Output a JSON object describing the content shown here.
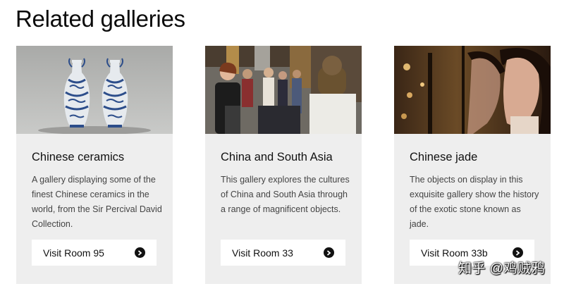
{
  "page": {
    "title": "Related galleries"
  },
  "galleries": [
    {
      "title": "Chinese ceramics",
      "description": "A gallery displaying some of the finest Chinese ceramics in the world, from the Sir Percival David Collection.",
      "link_label": "Visit Room 95",
      "image_subject": "blue-and-white-vases"
    },
    {
      "title": "China and South Asia",
      "description": "This gallery explores the cultures of China and South Asia through a range of magnificent objects.",
      "link_label": "Visit Room 33",
      "image_subject": "museum-visitors"
    },
    {
      "title": "Chinese jade",
      "description": "The objects on display in this exquisite gallery show the history of the exotic stone known as jade.",
      "link_label": "Visit Room 33b",
      "image_subject": "visitor-at-jade-display"
    }
  ],
  "watermark": "知乎 @鸡贼鸦",
  "colors": {
    "card_bg": "#eeeeee",
    "button_bg": "#ffffff",
    "text": "#111111",
    "muted": "#444444"
  },
  "icons": {
    "link_arrow": "arrow-right-circle-icon"
  }
}
